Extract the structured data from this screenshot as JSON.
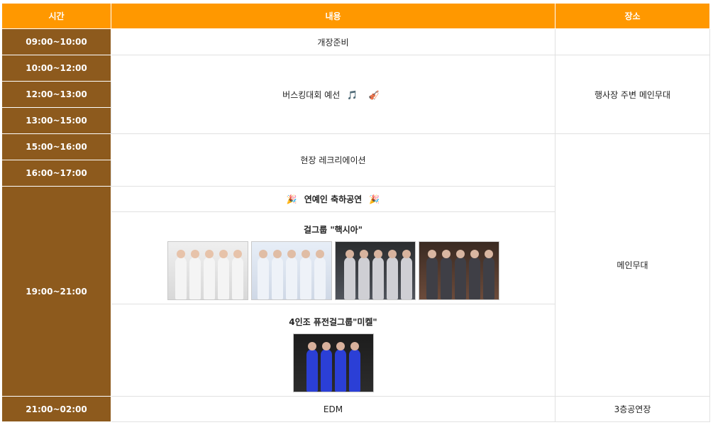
{
  "header": {
    "time": "시간",
    "content": "내용",
    "place": "장소"
  },
  "times": [
    "09:00~10:00",
    "10:00~12:00",
    "12:00~13:00",
    "13:00~15:00",
    "15:00~16:00",
    "16:00~17:00",
    "19:00~21:00",
    "21:00~02:00"
  ],
  "contents": {
    "prep": "개장준비",
    "busking": "버스킹대회 예선",
    "busking_emojis": [
      "🎵",
      "🎻"
    ],
    "recreation": "현장  레크리에이션",
    "celebrity": "연예인 축하공연",
    "celebrity_emojis": [
      "🎉",
      "🎉"
    ],
    "group1_title": "걸그룹 \"핵시아\"",
    "group2_title": "4인조 퓨전걸그룹\"미켈\"",
    "edm": "EDM"
  },
  "places": {
    "main_stage_area": "행사장 주변 메인무대",
    "main_stage": "메인무대",
    "third_floor": "3층공연장"
  },
  "colors": {
    "header": "#ff9800",
    "time": "#8d5a1d",
    "border": "#e1e1e1"
  },
  "icons": [
    "music-note-icon",
    "violin-icon",
    "party-popper-icon"
  ]
}
